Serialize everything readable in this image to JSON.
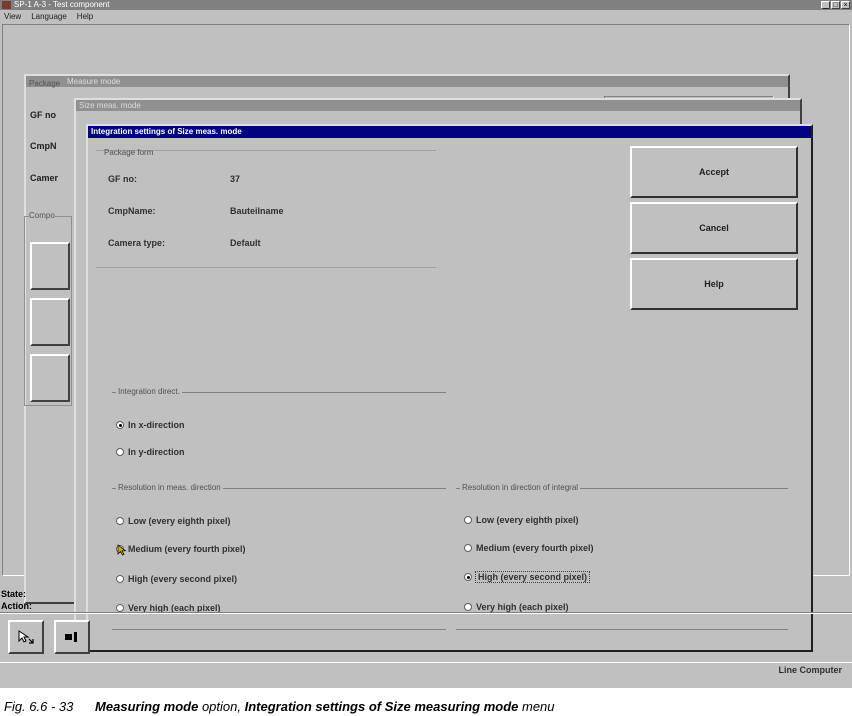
{
  "app": {
    "window_title": "SP-1 A-3 - Test component",
    "menus": [
      "View",
      "Language",
      "Help"
    ],
    "window_controls": [
      "_",
      "□",
      "×"
    ]
  },
  "background": {
    "meas_window_title": "Measure mode",
    "size_window_title": "Size meas. mode",
    "labels": [
      "Package",
      "GF no",
      "CmpN",
      "Camer",
      "Compo"
    ],
    "state_label": "State:",
    "action_label": "Action:",
    "status_text": "Line Computer"
  },
  "dialog": {
    "title": "Integration settings of Size meas. mode",
    "package_form": {
      "legend": "Package form",
      "fields": [
        {
          "label": "GF no:",
          "value": "37"
        },
        {
          "label": "CmpName:",
          "value": "Bauteilname"
        },
        {
          "label": "Camera type:",
          "value": "Default"
        }
      ]
    },
    "buttons": {
      "accept": "Accept",
      "cancel": "Cancel",
      "help": "Help"
    },
    "integration_direction": {
      "legend": "Integration direct.",
      "options": [
        "In x-direction",
        "In y-direction"
      ],
      "selected": 0
    },
    "resolution_meas": {
      "legend": "Resolution in meas. direction",
      "options": [
        "Low (every eighth pixel)",
        "Medium (every fourth pixel)",
        "High (every second pixel)",
        "Very high (each pixel)"
      ],
      "selected": 1
    },
    "resolution_integral": {
      "legend": "Resolution in direction of integral",
      "options": [
        "Low (every eighth pixel)",
        "Medium (every fourth pixel)",
        "High (every second pixel)",
        "Very high (each pixel)"
      ],
      "selected": 2
    }
  },
  "caption": {
    "fig": "Fig. 6.6 - 33",
    "bold1": "Measuring mode",
    "text1": " option, ",
    "bold2": "Integration settings of Size measuring mode",
    "text2": " menu"
  }
}
